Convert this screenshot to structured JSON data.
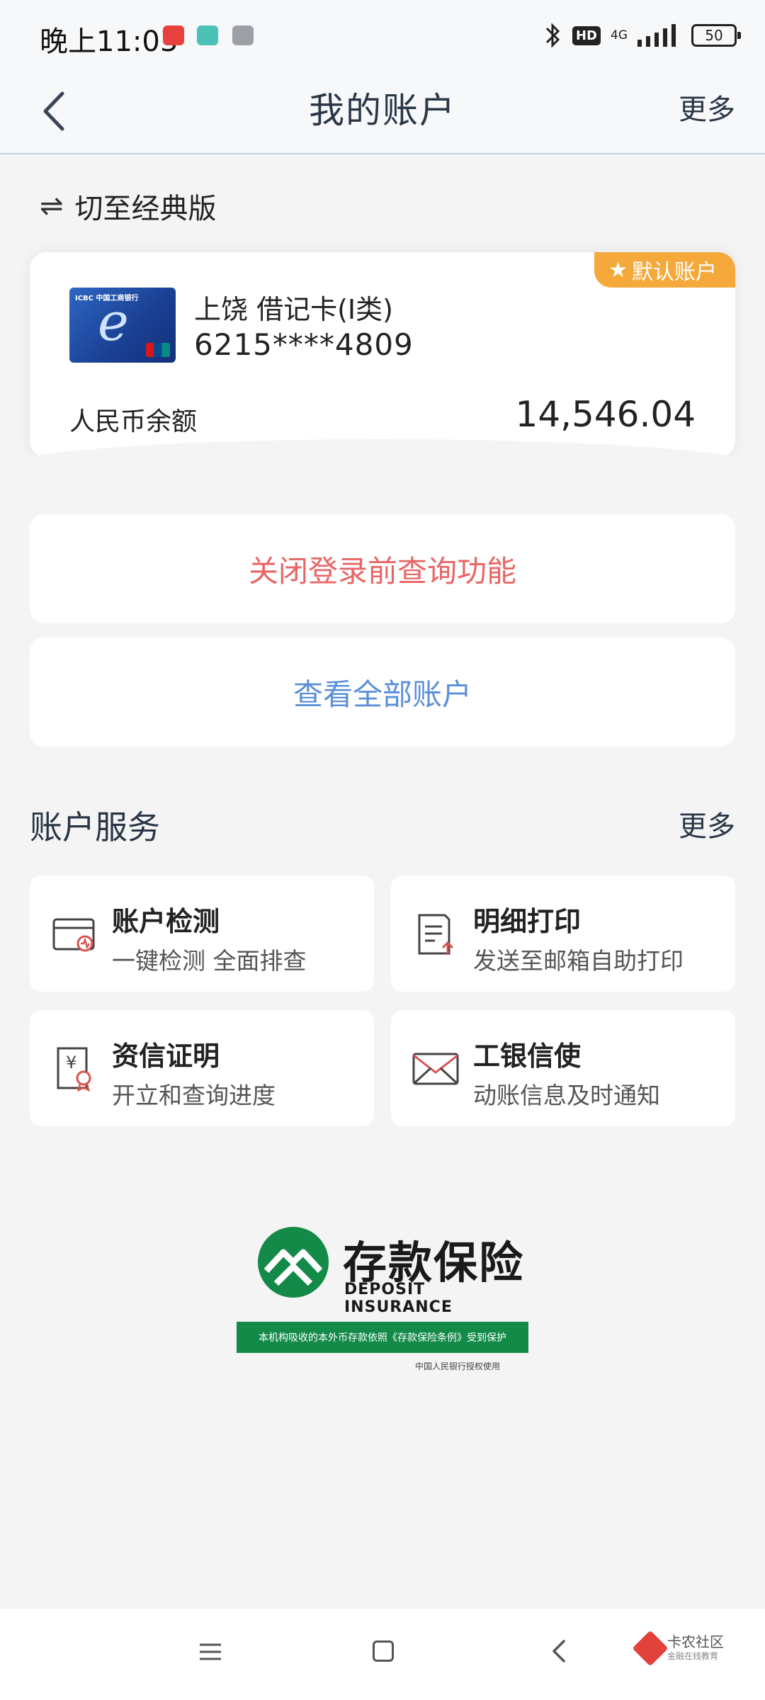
{
  "status_bar": {
    "time": "晚上11:03",
    "network": "4G",
    "hd": "HD",
    "battery": "50"
  },
  "header": {
    "title": "我的账户",
    "more": "更多"
  },
  "switch": {
    "label": "切至经典版"
  },
  "card": {
    "badge": "默认账户",
    "name": "上饶 借记卡(I类)",
    "number": "6215****4809",
    "balance_label": "人民币余额",
    "balance": "14,546.04",
    "card_bank_text": "ICBC 中国工商银行"
  },
  "actions": {
    "close_query": "关闭登录前查询功能",
    "view_all": "查看全部账户"
  },
  "services": {
    "title": "账户服务",
    "more": "更多",
    "items": [
      {
        "title": "账户检测",
        "subtitle": "一键检测 全面排查",
        "icon": "card-check-icon"
      },
      {
        "title": "明细打印",
        "subtitle": "发送至邮箱自助打印",
        "icon": "document-print-icon"
      },
      {
        "title": "资信证明",
        "subtitle": "开立和查询进度",
        "icon": "credit-certificate-icon"
      },
      {
        "title": "工银信使",
        "subtitle": "动账信息及时通知",
        "icon": "envelope-icon"
      }
    ]
  },
  "deposit_insurance": {
    "title_cn": "存款保险",
    "title_en": "DEPOSIT INSURANCE",
    "notice": "本机构吸收的本外币存款依照《存款保险条例》受到保护",
    "authorization": "中国人民银行授权使用"
  },
  "watermark": {
    "name": "卡农社区",
    "slogan": "金融在线教育"
  },
  "colors": {
    "accent_red": "#e86665",
    "accent_blue": "#5b8fd8",
    "badge_orange": "#f4a93a",
    "deposit_green": "#138a48"
  }
}
